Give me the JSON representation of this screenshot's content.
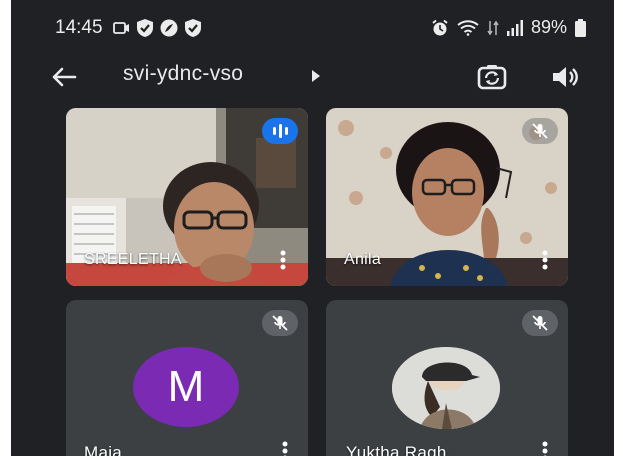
{
  "status_bar": {
    "time": "14:45",
    "battery": "89%"
  },
  "app_bar": {
    "meeting_code": "svi-ydnc-vso"
  },
  "participants": [
    {
      "name": "SREELETHA",
      "state": "speaking"
    },
    {
      "name": "Anila",
      "state": "muted"
    },
    {
      "name": "Maja",
      "state": "muted",
      "avatar_letter": "M",
      "avatar_color": "#7b2ab4"
    },
    {
      "name": "Yuktha Ragh...",
      "state": "muted"
    }
  ],
  "colors": {
    "background": "#202124",
    "tile": "#3c4043",
    "speaking_accent": "#1a73e8"
  }
}
